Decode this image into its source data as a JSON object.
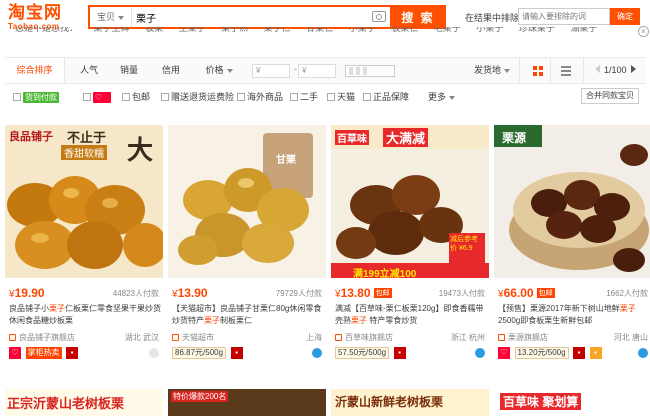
{
  "header": {
    "logo_main": "淘宝网",
    "logo_sub": "Taobao.com",
    "search_scope": "宝贝",
    "search_value": "栗子",
    "search_button": "搜 索",
    "exclude_label": "在结果中排除",
    "exclude_placeholder": "请输入要排除的词",
    "exclude_button": "确定"
  },
  "suggestions": [
    "您是不是想找：",
    "栗子生鲜",
    "板栗",
    "生栗子",
    "栗子熟",
    "栗子仁",
    "甘栗仁",
    "小栗子",
    "板栗仁",
    "毛栗子",
    "小栗子",
    "珍珠栗子",
    "油栗子",
    "栗子板"
  ],
  "sortbar": {
    "items": [
      "综合排序",
      "人气",
      "销量",
      "信用",
      "价格"
    ],
    "price_min_placeholder": "¥",
    "price_max_placeholder": "¥",
    "ship_from": "发货地",
    "page": "1/100"
  },
  "filters": {
    "items": [
      "货到付款",
      "包邮",
      "赠送退货运费险",
      "海外商品",
      "二手",
      "天猫",
      "正品保障"
    ],
    "more": "更多",
    "merge": "合并同款宝贝"
  },
  "products": [
    {
      "price": "19.90",
      "pay": "44823人付款",
      "title_pre": "良品铺子小",
      "title_hl": "栗子",
      "title_post": "仁板栗仁零食坚果干果炒货休闲食品糖炒板栗",
      "shop": "良品铺子旗舰店",
      "location": "湖北 武汉",
      "meta_tags": [
        "掌柜热卖"
      ],
      "pic_text": [
        "良品铺子",
        "不止于",
        "香甜软糯"
      ],
      "pic_sub_text": "大",
      "pic_label": ""
    },
    {
      "price": "13.90",
      "pay": "79729人付款",
      "title_pre": "【天猫超市】良品铺子甘栗仁80g休闲零食炒货特产",
      "title_hl": "栗子",
      "title_post": "制板栗仁",
      "shop": "天猫超市",
      "location": "上海",
      "meta_tags": [
        "86.87元/500g"
      ],
      "pic_text": [],
      "pic_sub_text": "",
      "pic_label": "甘栗"
    },
    {
      "price": "13.80",
      "pay": "19473人付款",
      "badge": "包邮",
      "title_pre": "满减【百草味-栗仁板栗120g】即食香糯带壳熟",
      "title_hl": "栗子",
      "title_post": " 特产零食炒货",
      "shop": "百草味旗舰店",
      "location": "浙江 杭州",
      "meta_tags": [
        "57.50元/500g"
      ],
      "pic_text": [
        "百草味",
        "大满减"
      ],
      "pic_sub_text": "满199立减100",
      "pic_label": "减后参考价 ¥6.9"
    },
    {
      "price": "66.00",
      "pay": "1662人付款",
      "badge": "包邮",
      "title_pre": "【预售】栗源2017年新下树山地鲜",
      "title_hl": "栗子",
      "title_post": "2500g即食板栗生新鲜包邮",
      "shop": "栗源旗舰店",
      "location": "河北 唐山",
      "meta_tags": [
        "13.20元/500g"
      ],
      "pic_text": [
        "栗源"
      ],
      "pic_sub_text": "",
      "pic_label": ""
    }
  ],
  "bottom_row": [
    "正宗沂蒙山老树板栗",
    "特价爆款200名",
    "沂蒙山新鲜老树板栗",
    "百草味 聚划算"
  ],
  "colors": {
    "accent": "#ff5000",
    "price": "#ff4400",
    "tmall": "#c40000"
  }
}
